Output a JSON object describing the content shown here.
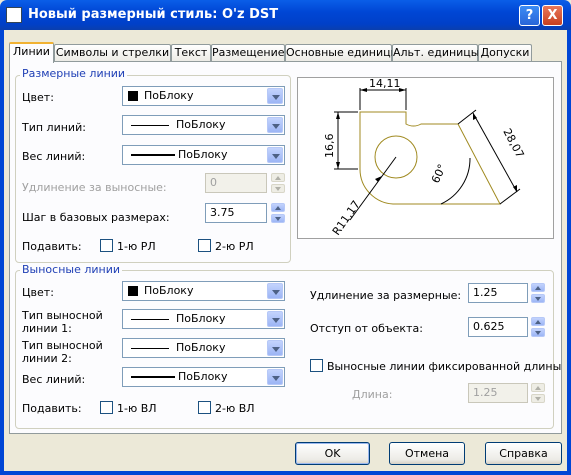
{
  "window": {
    "title": "Новый размерный стиль: O'z DST",
    "help_label": "?",
    "close_label": "X"
  },
  "tabs": [
    "Линии",
    "Символы и стрелки",
    "Текст",
    "Размещение",
    "Основные единицы",
    "Альт. единицы",
    "Допуски"
  ],
  "active_tab": "Линии",
  "dim_lines": {
    "title": "Размерные линии",
    "color_label": "Цвет:",
    "color_value": "ПоБлоку",
    "linetype_label": "Тип линий:",
    "linetype_value": "ПоБлоку",
    "lineweight_label": "Вес линий:",
    "lineweight_value": "ПоБлоку",
    "extend_label": "Удлинение за выносные:",
    "extend_value": "0",
    "baseline_label": "Шаг в базовых размерах:",
    "baseline_value": "3.75",
    "suppress_label": "Подавить:",
    "suppress_1": "1-ю РЛ",
    "suppress_2": "2-ю РЛ"
  },
  "ext_lines": {
    "title": "Выносные линии",
    "color_label": "Цвет:",
    "color_value": "ПоБлоку",
    "linetype1_label_a": "Тип выносной",
    "linetype1_label_b": "линии 1:",
    "linetype1_value": "ПоБлоку",
    "linetype2_label_a": "Тип выносной",
    "linetype2_label_b": "линии 2:",
    "linetype2_value": "ПоБлоку",
    "lineweight_label": "Вес линий:",
    "lineweight_value": "ПоБлоку",
    "suppress_label": "Подавить:",
    "suppress_1": "1-ю ВЛ",
    "suppress_2": "2-ю ВЛ",
    "extend_label": "Удлинение за размерные:",
    "extend_value": "1.25",
    "offset_label": "Отступ от объекта:",
    "offset_value": "0.625",
    "fixed_label": "Выносные линии фиксированной длины",
    "length_label": "Длина:",
    "length_value": "1.25"
  },
  "preview": {
    "dim_top": "14,11",
    "dim_left": "16,6",
    "dim_right": "28,07",
    "dim_angle": "60°",
    "dim_radius": "R11,17"
  },
  "buttons": {
    "ok": "OK",
    "cancel": "Отмена",
    "help": "Справка"
  },
  "colors": {
    "titlebar": "#0046d5",
    "dialog_bg": "#ece9d8",
    "group_title": "#1f3fb5",
    "drawing_line": "#a08a20"
  }
}
